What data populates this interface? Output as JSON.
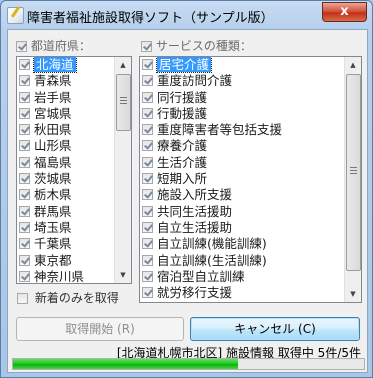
{
  "window": {
    "title": "障害者福祉施設取得ソフト（サンプル版）",
    "close_label": "x"
  },
  "prefecture_group": {
    "label": "都道府県：",
    "checked": true,
    "items": [
      {
        "label": "北海道",
        "checked": true,
        "selected": true
      },
      {
        "label": "青森県",
        "checked": true
      },
      {
        "label": "岩手県",
        "checked": true
      },
      {
        "label": "宮城県",
        "checked": true
      },
      {
        "label": "秋田県",
        "checked": true
      },
      {
        "label": "山形県",
        "checked": true
      },
      {
        "label": "福島県",
        "checked": true
      },
      {
        "label": "茨城県",
        "checked": true
      },
      {
        "label": "栃木県",
        "checked": true
      },
      {
        "label": "群馬県",
        "checked": true
      },
      {
        "label": "埼玉県",
        "checked": true
      },
      {
        "label": "千葉県",
        "checked": true
      },
      {
        "label": "東京都",
        "checked": true
      },
      {
        "label": "神奈川県",
        "checked": true
      }
    ]
  },
  "service_group": {
    "label": "サービスの種類：",
    "checked": true,
    "items": [
      {
        "label": "居宅介護",
        "checked": true,
        "selected": true
      },
      {
        "label": "重度訪問介護",
        "checked": true
      },
      {
        "label": "同行援護",
        "checked": true
      },
      {
        "label": "行動援護",
        "checked": true
      },
      {
        "label": "重度障害者等包括支援",
        "checked": true
      },
      {
        "label": "療養介護",
        "checked": true
      },
      {
        "label": "生活介護",
        "checked": true
      },
      {
        "label": "短期入所",
        "checked": true
      },
      {
        "label": "施設入所支援",
        "checked": true
      },
      {
        "label": "共同生活援助",
        "checked": true
      },
      {
        "label": "自立生活援助",
        "checked": true
      },
      {
        "label": "自立訓練(機能訓練)",
        "checked": true
      },
      {
        "label": "自立訓練(生活訓練)",
        "checked": true
      },
      {
        "label": "宿泊型自立訓練",
        "checked": true
      },
      {
        "label": "就労移行支援",
        "checked": true
      }
    ]
  },
  "options": {
    "new_only_label": "新着のみを取得",
    "new_only_checked": false
  },
  "buttons": {
    "start_label": "取得開始 (R)",
    "cancel_label": "キャンセル (C)"
  },
  "status": {
    "text": "[北海道札幌市北区] 施設情報 取得中 5件/5件",
    "progress": 0.64
  },
  "colors": {
    "selection": "#3399ff",
    "progress": "#0bb00b",
    "default_button": "#a7d9f5"
  }
}
